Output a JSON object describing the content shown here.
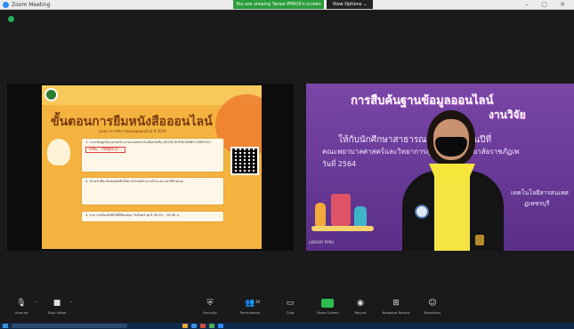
{
  "window": {
    "title": "Zoom Meeting",
    "share_banner": "You are viewing Yanee PPRUS's screen",
    "view_options": "View Options ⌄",
    "controls": "– ▢ ✕"
  },
  "left_slide": {
    "title": "ขั้นตอนการยืมหนังสือออนไลน์",
    "subtitle": "(เฉพาะการบริการห้องสมุดออนไลน์ ปี 2019",
    "step1": "1. กรอกข้อมูลในแบบฟอร์ม ผ่านแบบฟอร์มขอยืมหนังสือ (BOOK BORROWING SERVICE)",
    "url": "URL : https://...",
    "step2": "2. เจ้าหน้าที่จะจัดส่งหนังสือให้ทางไปรษณีย์ (ภายในระยะเวลาที่กำหนด)",
    "step3": "3. สามารถคืนหนังสือได้ที่ห้องสมุด วันจันทร์–ศุกร์ 08.30 – 16.30 น."
  },
  "right_slide": {
    "title_line1": "การสืบค้นฐานข้อมูลออนไลน์",
    "title_line2": "งานวิจัย",
    "line1": "ให้กับนักศึกษาสาธารณสุขศาสตร์ ชั้นปีที่",
    "line2": "คณะพยาบาลศาสตร์และวิทยาการสุขภาพ มหาวิทยาลัยราชภัฏเพ",
    "line3": "วันที่ 2564",
    "line4": "เทคโนโลยีสารสนเทศ",
    "line5": "ฏเพชรบุรี",
    "footer": "LIBRARY PPRU"
  },
  "toolbar": {
    "items": [
      {
        "label": "Unmute",
        "icon": "microphone-muted-icon"
      },
      {
        "label": "Stop Video",
        "icon": "video-camera-icon"
      },
      {
        "label": "Security",
        "icon": "shield-icon"
      },
      {
        "label": "Participants",
        "icon": "participants-icon",
        "count": "30"
      },
      {
        "label": "Chat",
        "icon": "chat-icon"
      },
      {
        "label": "Share Screen",
        "icon": "share-screen-icon"
      },
      {
        "label": "Record",
        "icon": "record-icon"
      },
      {
        "label": "Breakout Rooms",
        "icon": "breakout-rooms-icon"
      },
      {
        "label": "Reactions",
        "icon": "reactions-icon"
      }
    ]
  },
  "colors": {
    "share_green": "#2a9d3a",
    "zoom_blue": "#2d8cff",
    "slide_orange": "#f4b33e",
    "slide_purple": "#6a3c96"
  }
}
